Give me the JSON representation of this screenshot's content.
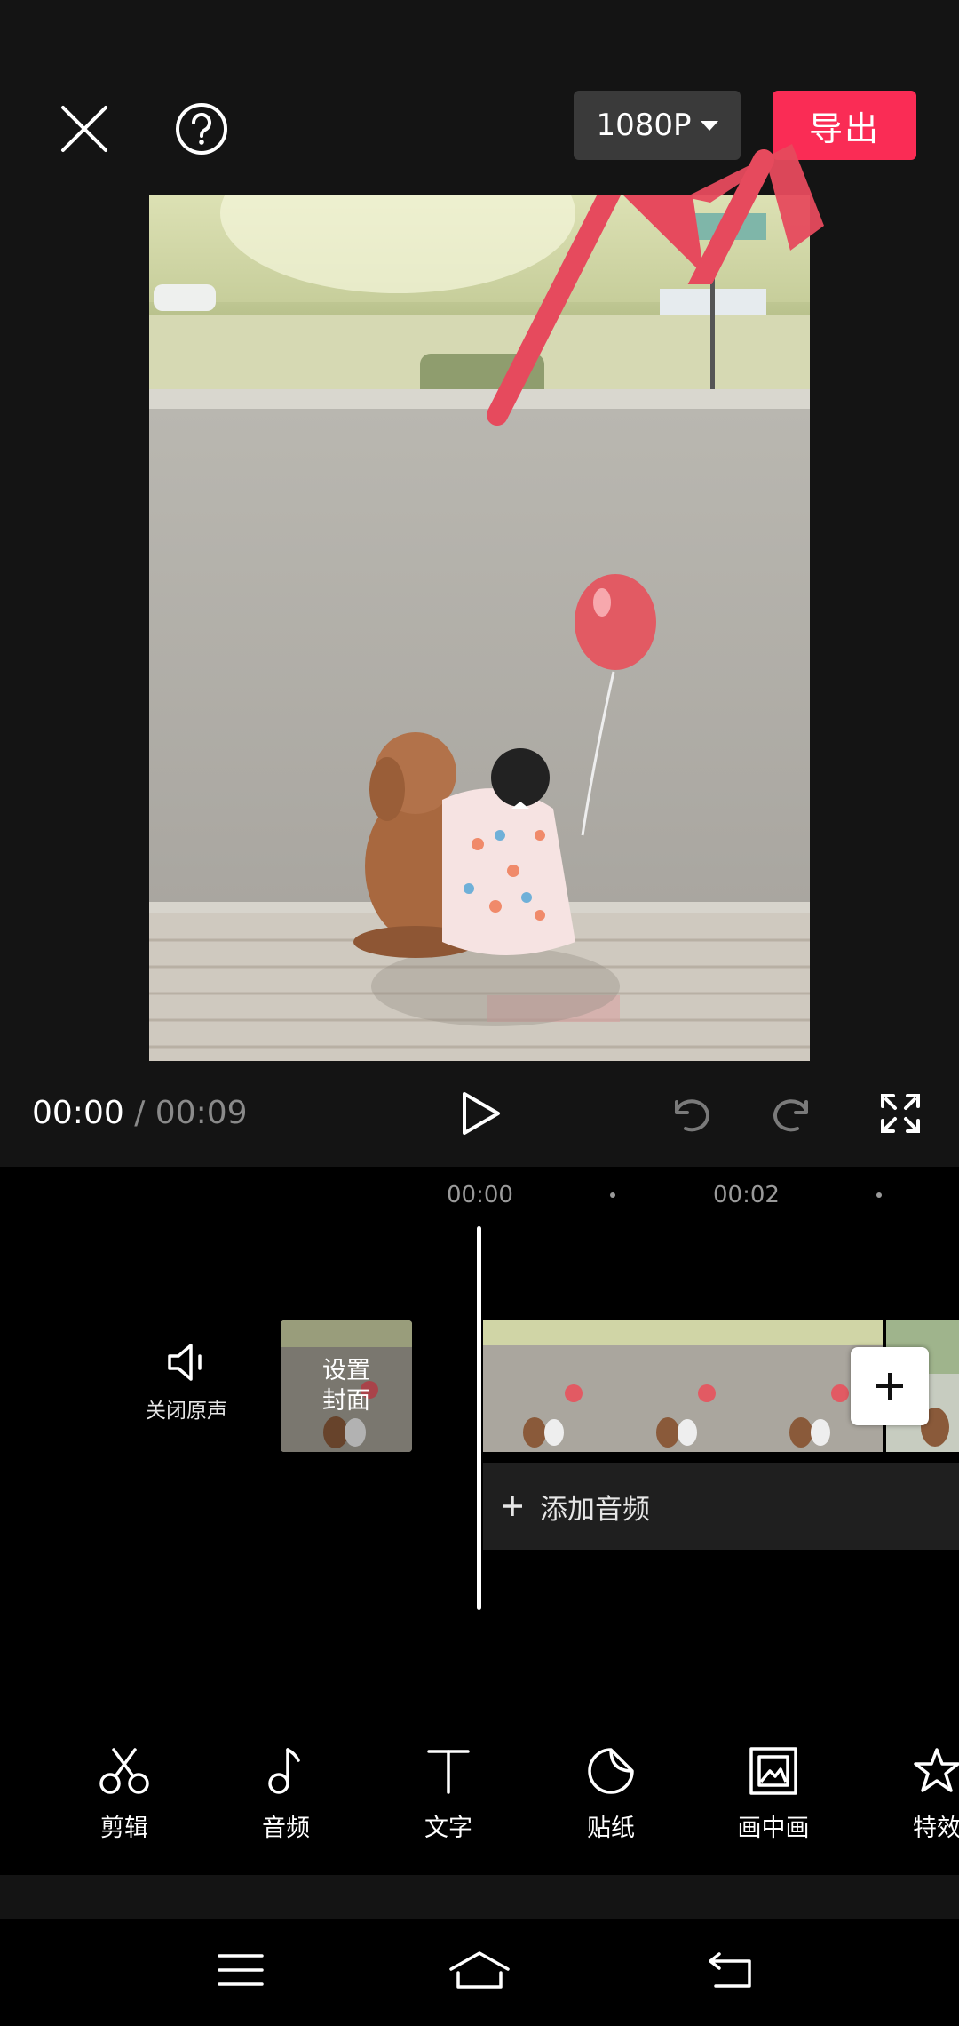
{
  "header": {
    "close_icon": "close-icon",
    "help_icon": "help-icon",
    "resolution_label": "1080P",
    "export_label": "导出",
    "accent_color": "#fa2c55"
  },
  "player": {
    "current_time": "00:00",
    "separator": "/",
    "total_time": "00:09",
    "play_icon": "play-icon",
    "undo_icon": "undo-icon",
    "redo_icon": "redo-icon",
    "fullscreen_icon": "fullscreen-icon"
  },
  "timeline": {
    "ruler": [
      "00:00",
      "00:02"
    ],
    "mute_label": "关闭原声",
    "cover_label": "设置\n封面",
    "add_audio_label": "添加音频"
  },
  "toolbar": {
    "items": [
      {
        "label": "剪辑",
        "icon": "scissors-icon"
      },
      {
        "label": "音频",
        "icon": "music-note-icon"
      },
      {
        "label": "文字",
        "icon": "text-icon"
      },
      {
        "label": "贴纸",
        "icon": "sticker-icon"
      },
      {
        "label": "画中画",
        "icon": "picture-in-picture-icon"
      },
      {
        "label": "特效",
        "icon": "effects-star-icon"
      }
    ]
  },
  "system_nav": {
    "menu_icon": "menu-icon",
    "home_icon": "home-icon",
    "back_icon": "back-icon"
  }
}
